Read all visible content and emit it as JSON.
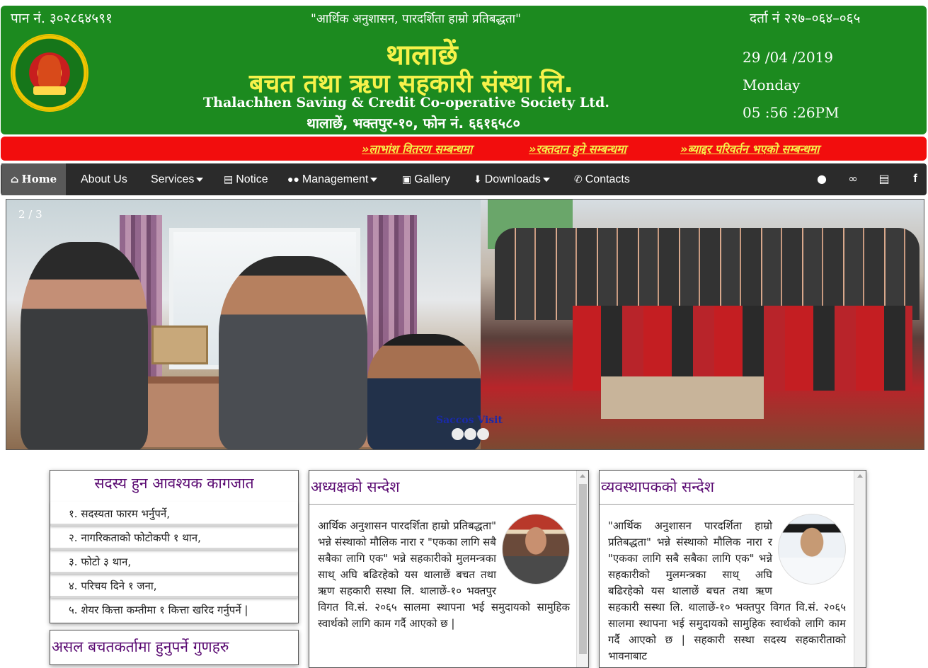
{
  "header": {
    "pan": "पान नं. ३०२८६४५९१",
    "slogan": "\"आर्थिक अनुशासन, पारदर्शिता हाम्रो प्रतिबद्धता\"",
    "darta": "दर्ता नं २२७–०६४–०६५",
    "title_line1": "थालाछें",
    "title_line2": "बचत तथा ऋण सहकारी संस्था लि.",
    "title_english": "Thalachhen Saving & Credit Co-operative Society Ltd.",
    "address": "थालाछें, भक्तपुर-१०, फोन नं. ६६१६५८०",
    "date": "29 /04 /2019",
    "day": "Monday",
    "time": "05 :56 :26PM",
    "colors": {
      "background": "#1c8a1f",
      "title": "#f6f24a"
    }
  },
  "ticker": {
    "items": [
      "»लाभांश वितरण सम्बन्धमा",
      "»रक्तदान हुने सम्बन्धमा",
      "»ब्याद्दर परिवर्तन भएको सम्बन्धमा"
    ],
    "colors": {
      "background": "#f20d0d",
      "text": "#f6f24a"
    }
  },
  "nav": {
    "home": "Home",
    "about": "About Us",
    "services": "Services",
    "notice": "Notice",
    "management": "Management",
    "gallery": "Gallery",
    "downloads": "Downloads",
    "contacts": "Contacts",
    "icons": [
      "home-icon",
      "file-icon",
      "users-icon",
      "image-icon",
      "download-icon",
      "phone-icon",
      "comment-icon",
      "link-icon",
      "newspaper-icon",
      "facebook-icon"
    ]
  },
  "slider": {
    "counter": "2 / 3",
    "caption": "Saccos Visit"
  },
  "docs": {
    "title": "सदस्य हुन आवश्यक कागजात",
    "items": [
      "१. सदस्यता फारम भर्नुपर्ने,",
      "२. नागरिकताको फोटोकपी १ थान,",
      "३. फोटो ३ थान,",
      "४. परिचय दिने १ जना,",
      "५. शेयर कित्ता कम्तीमा १ कित्ता खरिद गर्नुपर्ने |"
    ]
  },
  "quality": {
    "title": "असल बचतकर्तामा हुनुपर्ने गुणहरु"
  },
  "chairman": {
    "title": "अध्यक्षको सन्देश",
    "body": "आर्थिक अनुशासन पारदर्शिता हाम्रो प्रतिबद्धता\" भन्ने संस्थाको मौलिक नारा र \"एकका लागि सबै सबैका लागि एक\" भन्ने सहकारीको मुलमन्त्रका साथ् अघि बढिरहेको यस थालाछें बचत तथा ऋण सहकारी सस्था लि. थालाछें-१० भक्तपुर विगत वि.सं. २०६५ सालमा स्थापना भई समुदायको सामुहिक स्वार्थको लागि काम गर्दै आएको छ |"
  },
  "manager": {
    "title": "व्यवस्थापकको सन्देश",
    "body": "\"आर्थिक अनुशासन पारदर्शिता हाम्रो प्रतिबद्धता\" भन्ने संस्थाको मौलिक नारा र \"एकका लागि सबै सबैका लागि एक\" भन्ने सहकारीको मुलमन्त्रका साथ् अघि बढिरहेको यस थालाछें बचत तथा ऋण सहकारी सस्था लि. थालाछें-१० भक्तपुर विगत वि.सं. २०६५ सालमा स्थापना भई समुदायको सामुहिक स्वार्थको लागि काम गर्दै आएको छ | सहकारी सस्था सदस्य सहकारीताको भावनाबाट"
  }
}
